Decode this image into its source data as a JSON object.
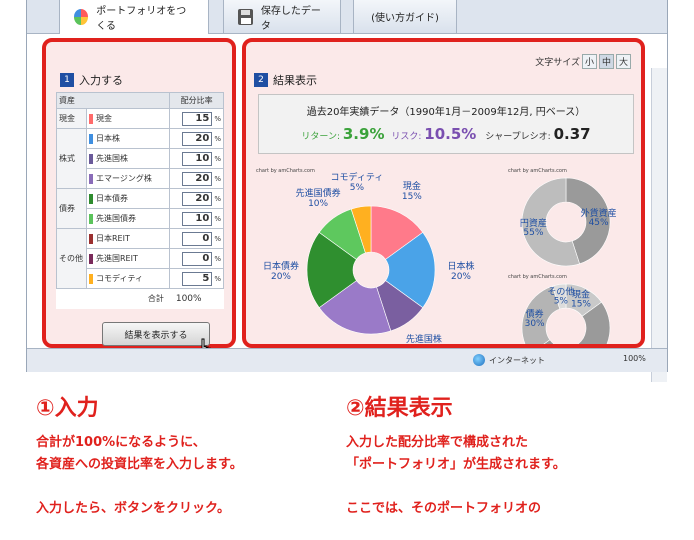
{
  "tabs": [
    {
      "label": "ポートフォリオをつくる",
      "active": true
    },
    {
      "label": "保存したデータ",
      "active": false
    },
    {
      "label": "(使い方ガイド)",
      "active": false
    }
  ],
  "input_section": {
    "num": "1",
    "title": "入力する",
    "col_asset": "資産",
    "col_ratio": "配分比率",
    "rows": [
      {
        "category": "現金",
        "asset": "現金",
        "value": "15",
        "color": "#ff6b6b"
      },
      {
        "category": "株式",
        "asset": "日本株",
        "value": "20",
        "color": "#3f8fe0"
      },
      {
        "category": "",
        "asset": "先進国株",
        "value": "10",
        "color": "#6a5a9a"
      },
      {
        "category": "",
        "asset": "エマージング株",
        "value": "20",
        "color": "#8a6cb8"
      },
      {
        "category": "債券",
        "asset": "日本債券",
        "value": "20",
        "color": "#2e8b2e"
      },
      {
        "category": "",
        "asset": "先進国債券",
        "value": "10",
        "color": "#5bc35b"
      },
      {
        "category": "その他",
        "asset": "日本REIT",
        "value": "0",
        "color": "#9b3030"
      },
      {
        "category": "",
        "asset": "先進国REIT",
        "value": "0",
        "color": "#7a2a5a"
      },
      {
        "category": "",
        "asset": "コモディティ",
        "value": "5",
        "color": "#ffb020"
      }
    ],
    "unit": "%",
    "total_label": "合計",
    "total_value": "100%",
    "button_label": "結果を表示する"
  },
  "result_section": {
    "num": "2",
    "title": "結果表示",
    "font_size_label": "文字サイズ",
    "font_sizes": [
      "小",
      "中",
      "大"
    ],
    "summary_title": "過去20年実績データ（1990年1月－2009年12月, 円ベース）",
    "return_label": "リターン:",
    "return_value": "3.9%",
    "risk_label": "リスク:",
    "risk_value": "10.5%",
    "sharpe_label": "シャープレシオ:",
    "sharpe_value": "0.37",
    "credit": "chart by amCharts.com"
  },
  "chart_data": [
    {
      "type": "pie",
      "slices": [
        {
          "label": "現金",
          "value": 15,
          "color": "#ff7a8a"
        },
        {
          "label": "日本株",
          "value": 20,
          "color": "#4aa3e8"
        },
        {
          "label": "先進国株",
          "value": 10,
          "color": "#7a5fa0"
        },
        {
          "label": "エマージング株",
          "value": 20,
          "color": "#9a7ac8"
        },
        {
          "label": "日本債券",
          "value": 20,
          "color": "#2f8f2f"
        },
        {
          "label": "先進国債券",
          "value": 10,
          "color": "#5ec85e"
        },
        {
          "label": "コモディティ",
          "value": 5,
          "color": "#ffb020"
        }
      ],
      "credit": "chart by amCharts.com"
    },
    {
      "type": "pie",
      "slices": [
        {
          "label": "外貨資産",
          "value": 45,
          "color": "#9a9a9a"
        },
        {
          "label": "円資産",
          "value": 55,
          "color": "#bdbdbd"
        }
      ],
      "credit": "chart by amCharts.com"
    },
    {
      "type": "pie",
      "slices": [
        {
          "label": "現金",
          "value": 15,
          "color": "#c9c9c9"
        },
        {
          "label": "株式",
          "value": 50,
          "color": "#9a9a9a"
        },
        {
          "label": "債券",
          "value": 30,
          "color": "#b4b4b4"
        },
        {
          "label": "その他",
          "value": 5,
          "color": "#dcdcdc"
        }
      ],
      "credit": "chart by amCharts.com"
    }
  ],
  "statusbar": {
    "zone": "インターネット",
    "zoom": "100%"
  },
  "captions": {
    "left_head": "①入力",
    "left_lines": [
      "合計が100%になるように、",
      "各資産への投資比率を入力します。",
      "",
      "入力したら、ボタンをクリック。"
    ],
    "right_head": "②結果表示",
    "right_lines": [
      "入力した配分比率で構成された",
      "「ポートフォリオ」が生成されます。",
      "",
      "ここでは、そのポートフォリオの"
    ]
  }
}
